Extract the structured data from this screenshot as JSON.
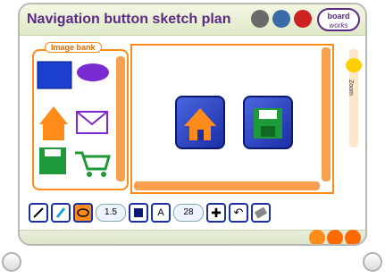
{
  "title": "Navigation button sketch plan",
  "logo": {
    "line1": "board",
    "line2": "works"
  },
  "image_bank": {
    "label": "Image bank",
    "items": [
      "rectangle-shape",
      "ellipse-shape",
      "house-icon",
      "envelope-icon",
      "save-disk-icon",
      "shopping-cart-icon"
    ]
  },
  "canvas_buttons": [
    "home-button-sketch",
    "save-button-sketch"
  ],
  "zoom_label": "Zoom",
  "toolbar": {
    "line_width": "1.5",
    "font_size": "28",
    "tools": [
      "line-tool",
      "pen-tool",
      "ellipse-tool",
      "fill-color",
      "text-tool",
      "move-tool",
      "undo-tool",
      "eraser-tool"
    ]
  },
  "colors": {
    "accent": "#ff8c1a",
    "title": "#5a2a84",
    "button": "#1b2fa8"
  }
}
